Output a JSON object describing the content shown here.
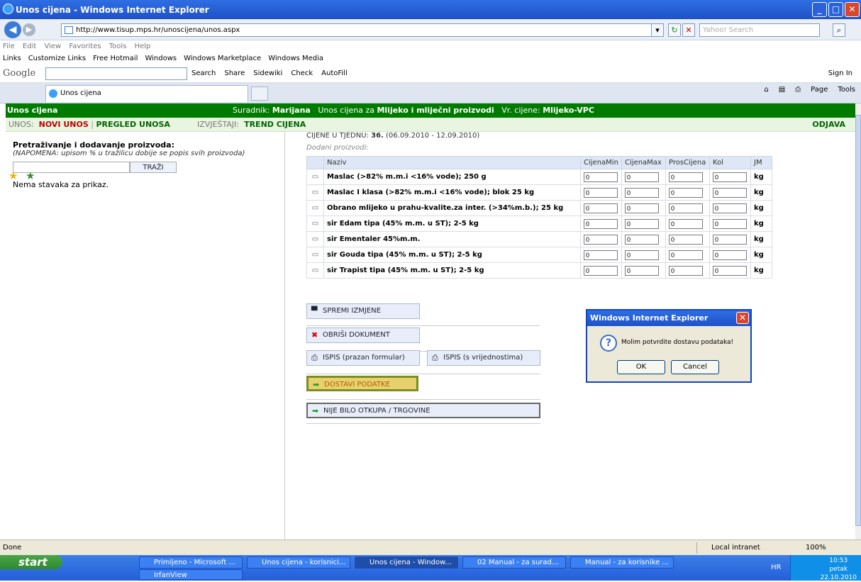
{
  "window": {
    "title": "Unos cijena - Windows Internet Explorer"
  },
  "address": {
    "url": "http://www.tisup.mps.hr/unoscijena/unos.aspx",
    "search_placeholder": "Yahoo! Search"
  },
  "menu": [
    "File",
    "Edit",
    "View",
    "Favorites",
    "Tools",
    "Help"
  ],
  "links": [
    "Links",
    "Customize Links",
    "Free Hotmail",
    "Windows",
    "Windows Marketplace",
    "Windows Media"
  ],
  "google_toolbar": {
    "logo": "Google",
    "items": [
      "Search",
      "Share",
      "Sidewiki",
      "Check",
      "AutoFill"
    ],
    "sign_in": "Sign In"
  },
  "tab": {
    "label": "Unos cijena"
  },
  "command_bar": [
    "Page",
    "Tools"
  ],
  "header": {
    "title": "Unos cijena",
    "user_label": "Suradnik:",
    "user": "Marijana",
    "entry_label": "Unos cijena za",
    "category": "Mlijeko i mliječni proizvodi",
    "type_label": "Vr. cijene:",
    "type": "Mlijeko-VPC"
  },
  "nav": {
    "unos_label": "UNOS:",
    "novi_unos": "NOVI UNOS",
    "pregled": "PREGLED UNOSA",
    "izvjestaji_label": "IZVJEŠTAJI:",
    "trend": "TREND CIJENA",
    "odjava": "ODJAVA"
  },
  "search": {
    "title": "Pretraživanje i dodavanje proizvoda:",
    "note": "(NAPOMENA: upisom % u tražilicu dobije se popis svih proizvoda)",
    "button": "TRAŽI",
    "empty": "Nema stavaka za prikaz."
  },
  "week": {
    "prefix": "CIJENE U TJEDNU:",
    "number": "36.",
    "range": "(06.09.2010 - 12.09.2010)"
  },
  "added_label": "Dodani proizvodi:",
  "table": {
    "headers": [
      "Naziv",
      "CijenaMin",
      "CijenaMax",
      "ProsCijena",
      "Kol",
      "JM"
    ],
    "rows": [
      {
        "name": "Maslac (>82% m.m.i <16% vode); 250 g",
        "min": "0",
        "max": "0",
        "avg": "0",
        "kol": "0",
        "jm": "kg"
      },
      {
        "name": "Maslac I klasa (>82% m.m.i <16% vode); blok 25 kg",
        "min": "0",
        "max": "0",
        "avg": "0",
        "kol": "0",
        "jm": "kg"
      },
      {
        "name": "Obrano mlijeko u prahu-kvalite.za inter. (>34%m.b.); 25 kg",
        "min": "0",
        "max": "0",
        "avg": "0",
        "kol": "0",
        "jm": "kg"
      },
      {
        "name": "sir Edam tipa (45% m.m. u ST); 2-5 kg",
        "min": "0",
        "max": "0",
        "avg": "0",
        "kol": "0",
        "jm": "kg"
      },
      {
        "name": "sir Ementaler 45%m.m.",
        "min": "0",
        "max": "0",
        "avg": "0",
        "kol": "0",
        "jm": "kg"
      },
      {
        "name": "sir Gouda tipa (45% m.m. u ST); 2-5 kg",
        "min": "0",
        "max": "0",
        "avg": "0",
        "kol": "0",
        "jm": "kg"
      },
      {
        "name": "sir Trapist tipa (45% m.m. u ST); 2-5 kg",
        "min": "0",
        "max": "0",
        "avg": "0",
        "kol": "0",
        "jm": "kg"
      }
    ]
  },
  "actions": {
    "save": "SPREMI IZMJENE",
    "delete": "OBRIŠI DOKUMENT",
    "print_empty": "ISPIS (prazan formular)",
    "print_values": "ISPIS (s vrijednostima)",
    "submit": "DOSTAVI PODATKE",
    "no_trade": "NIJE BILO OTKUPA / TRGOVINE"
  },
  "dialog": {
    "title": "Windows Internet Explorer",
    "message": "Molim potvrdite dostavu podataka!",
    "ok": "OK",
    "cancel": "Cancel"
  },
  "status": {
    "text": "Done",
    "zone": "Local intranet",
    "zoom": "100%"
  },
  "taskbar": {
    "start": "start",
    "tasks": [
      "Primljeno - Microsoft ...",
      "Unos cijena - korisnici...",
      "Unos cijena - Window...",
      "02 Manual - za surad...",
      "Manual - za korisnike ..."
    ],
    "irfan": "IrfanView",
    "lang": "HR",
    "time": "10:53",
    "day": "petak",
    "date": "22.10.2010"
  },
  "colors": {
    "header_green": "#007b00",
    "nav_bg": "#e8f5e0",
    "title_blue": "#2f6ee3"
  }
}
